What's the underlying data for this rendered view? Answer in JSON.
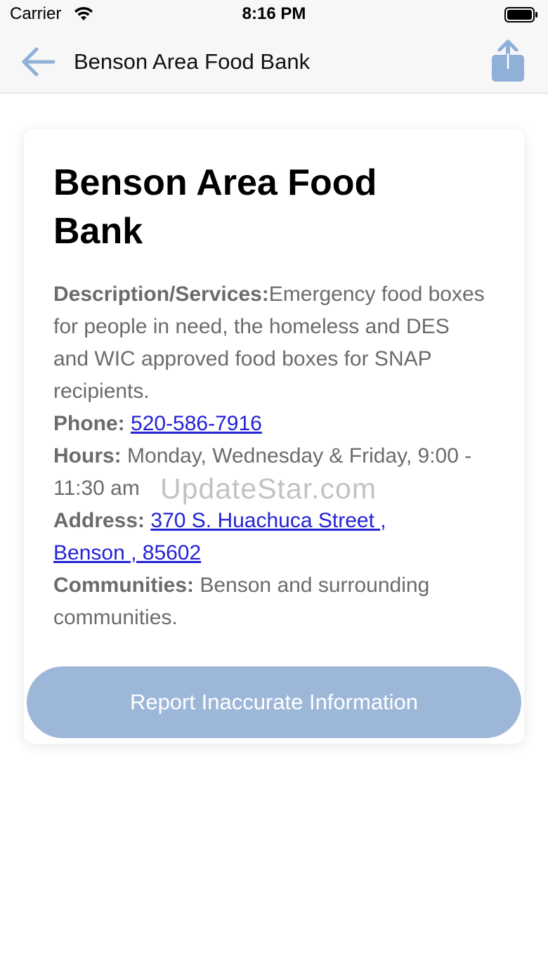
{
  "status_bar": {
    "carrier": "Carrier",
    "time": "8:16 PM",
    "wifi_icon": "wifi-icon",
    "battery_icon": "battery-icon"
  },
  "nav": {
    "back_icon": "arrow-left-icon",
    "title": "Benson Area Food Bank",
    "share_icon": "share-icon",
    "accent_color": "#8fb0d8"
  },
  "card": {
    "title": "Benson Area Food Bank",
    "description_label": "Description/Services:",
    "description_value": "Emergency food boxes for people in need, the homeless and DES and WIC approved food boxes for SNAP recipients.",
    "phone_label": "Phone:",
    "phone_value": "520-586-7916",
    "hours_label": "Hours:",
    "hours_value": "Monday, Wednesday & Friday, 9:00 - 11:30 am",
    "address_label": "Address:",
    "address_line1": "370 S. Huachuca Street ,",
    "address_line2": "Benson , 85602",
    "communities_label": "Communities:",
    "communities_value": "Benson and surrounding communities.",
    "link_color": "#2323d6"
  },
  "report_button": {
    "label": "Report Inaccurate Information",
    "color": "#9db7d8"
  },
  "watermark": "UpdateStar.com"
}
